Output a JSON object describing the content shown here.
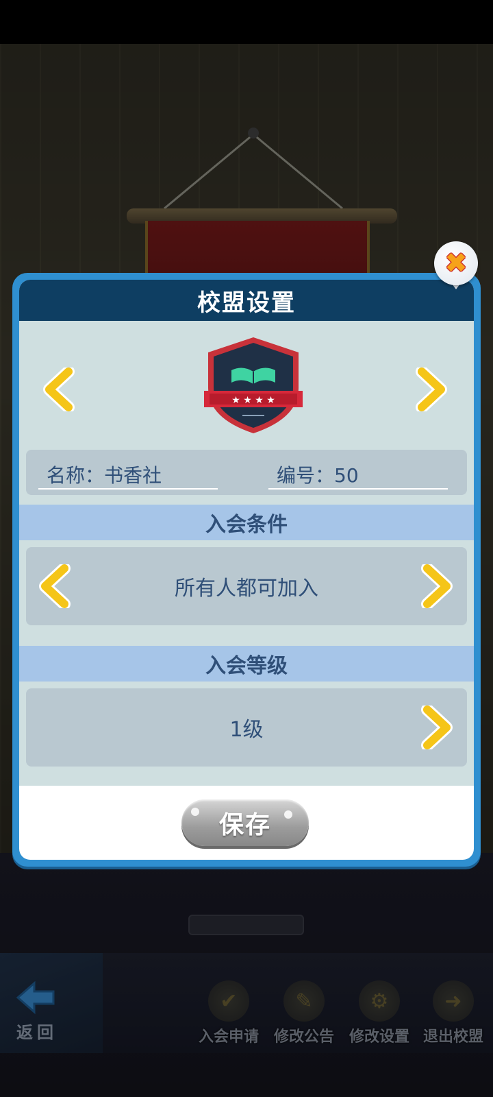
{
  "dialog": {
    "title": "校盟设置",
    "name_label": "名称：书香社",
    "id_label": "编号：50",
    "join_condition": {
      "header": "入会条件",
      "value": "所有人都可加入"
    },
    "join_level": {
      "header": "入会等级",
      "value": "1级"
    },
    "save_label": "保存"
  },
  "bottom_bar": {
    "back_label": "返回",
    "actions": [
      {
        "label": "入会申请",
        "icon": "application-icon"
      },
      {
        "label": "修改公告",
        "icon": "notice-edit-icon"
      },
      {
        "label": "修改设置",
        "icon": "gear-icon"
      },
      {
        "label": "退出校盟",
        "icon": "exit-icon"
      }
    ]
  },
  "colors": {
    "dialog_frame": "#2f8fd0",
    "dialog_header": "#0e3e62",
    "section_header": "#a6c5e8",
    "text": "#2f4f78",
    "arrow": "#f5c518"
  }
}
